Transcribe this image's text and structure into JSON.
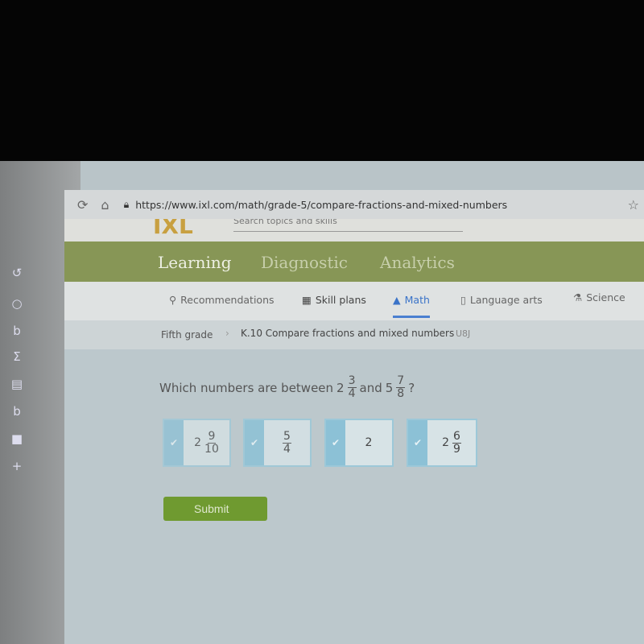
{
  "browser": {
    "url": "https://www.ixl.com/math/grade-5/compare-fractions-and-mixed-numbers"
  },
  "header": {
    "logo": "IXL",
    "search_placeholder": "Search topics and skills"
  },
  "main_tabs": [
    "Learning",
    "Diagnostic",
    "Analytics"
  ],
  "nav": [
    {
      "label": "Recommendations",
      "icon": "recommendations-icon"
    },
    {
      "label": "Skill plans",
      "icon": "skill-plans-icon"
    },
    {
      "label": "Math",
      "icon": "math-pyramid-icon",
      "active": true
    },
    {
      "label": "Language arts",
      "icon": "book-icon"
    },
    {
      "label": "Science",
      "icon": "flask-icon"
    }
  ],
  "breadcrumb": {
    "grade": "Fifth grade",
    "skill": "K.10 Compare fractions and mixed numbers",
    "code": "U8J"
  },
  "question": {
    "prefix": "Which numbers are between",
    "a_whole": "2",
    "a_num": "3",
    "a_den": "4",
    "and": "and",
    "b_whole": "5",
    "b_num": "7",
    "b_den": "8",
    "suffix": "?"
  },
  "answers": [
    {
      "whole": "2",
      "num": "9",
      "den": "10"
    },
    {
      "whole": "",
      "num": "5",
      "den": "4"
    },
    {
      "whole": "2",
      "num": "",
      "den": ""
    },
    {
      "whole": "2",
      "num": "6",
      "den": "9"
    }
  ],
  "submit_label": "Submit",
  "colors": {
    "green_band": "#879656",
    "submit": "#6f9a30",
    "accent_blue": "#8cc1d6"
  }
}
